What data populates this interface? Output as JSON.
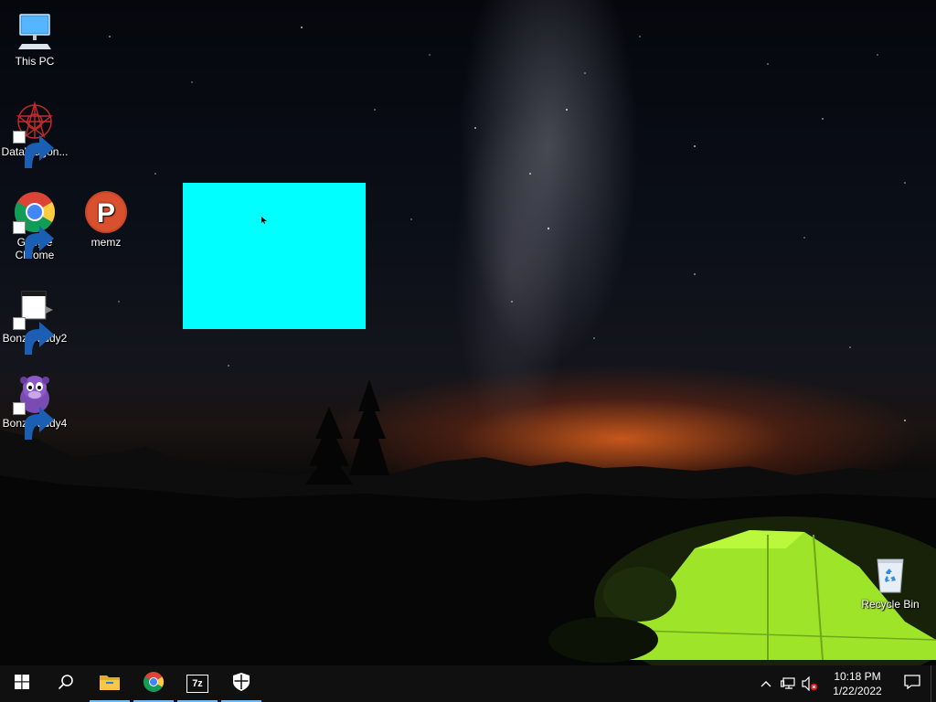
{
  "desktop": {
    "icons": [
      {
        "label": "This PC",
        "icon": "computer-icon"
      },
      {
        "label": "DataWagon...",
        "icon": "datawagon-icon"
      },
      {
        "label": "Google\nChrome",
        "icon": "chrome-icon"
      },
      {
        "label": "memz",
        "icon": "memz-icon"
      },
      {
        "label": "BonziBuddy2",
        "icon": "bonzibuddy2-icon"
      },
      {
        "label": "BonziBuddy4",
        "icon": "bonzibuddy-icon"
      },
      {
        "label": "Recycle Bin",
        "icon": "recycle-bin-icon"
      }
    ],
    "overlay_color": "#00ffff"
  },
  "taskbar": {
    "buttons": [
      {
        "name": "start",
        "icon": "windows-start-icon"
      },
      {
        "name": "search",
        "icon": "search-icon"
      },
      {
        "name": "file-explorer",
        "icon": "folder-icon",
        "running": true
      },
      {
        "name": "chrome",
        "icon": "chrome-icon",
        "running": true
      },
      {
        "name": "7zip",
        "icon": "7zip-icon",
        "label": "7z",
        "running": true
      },
      {
        "name": "defender",
        "icon": "shield-icon",
        "running": true
      }
    ],
    "tray": {
      "time": "10:18 PM",
      "date": "1/22/2022",
      "icons": [
        "chevron-up-icon",
        "network-icon",
        "volume-muted-icon"
      ],
      "notification_icon": "notification-icon"
    },
    "accent_color": "#76b9ed",
    "background_color": "#101010"
  }
}
